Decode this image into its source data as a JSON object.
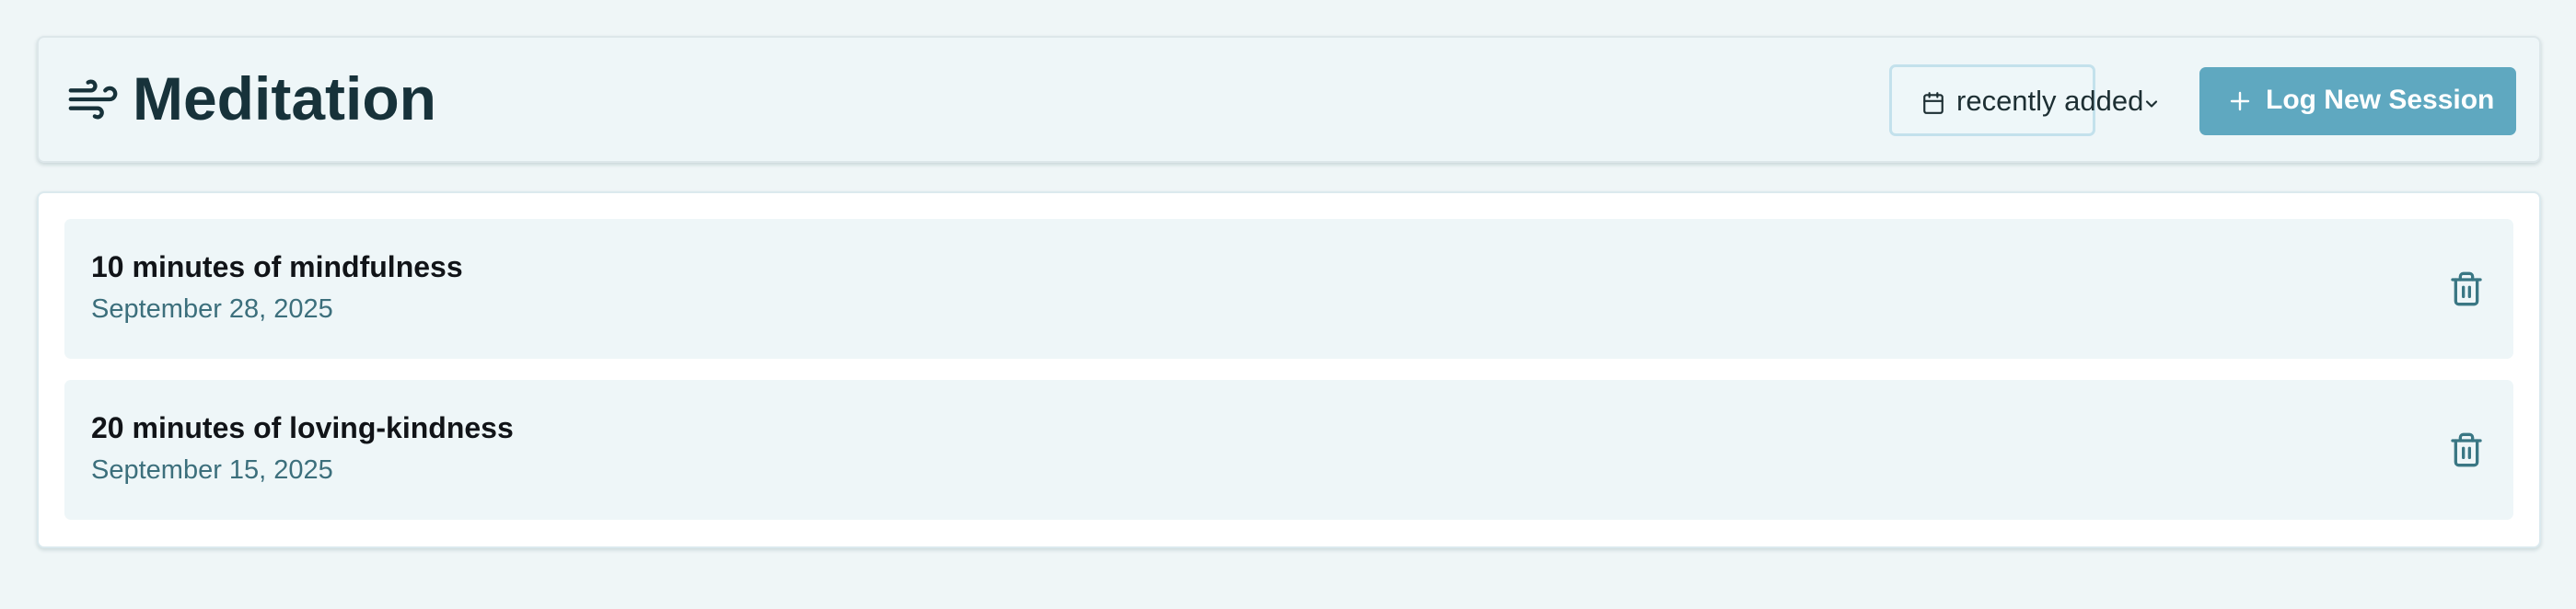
{
  "header": {
    "title": "Meditation",
    "title_icon": "wind-icon",
    "sort": {
      "icon": "calendar-icon",
      "label": "recently added",
      "chevron_icon": "chevron-down-icon"
    },
    "log_button": {
      "icon": "plus-icon",
      "label": "Log New Session"
    }
  },
  "sessions": [
    {
      "title": "10 minutes of mindfulness",
      "date": "September 28, 2025",
      "delete_icon": "trash-icon"
    },
    {
      "title": "20 minutes of loving-kindness",
      "date": "September 15, 2025",
      "delete_icon": "trash-icon"
    }
  ],
  "colors": {
    "background": "#eff6f7",
    "primary": "#5fa8c0",
    "title_text": "#17323a",
    "date_text": "#3c6f7c",
    "icon": "#3a7784"
  }
}
